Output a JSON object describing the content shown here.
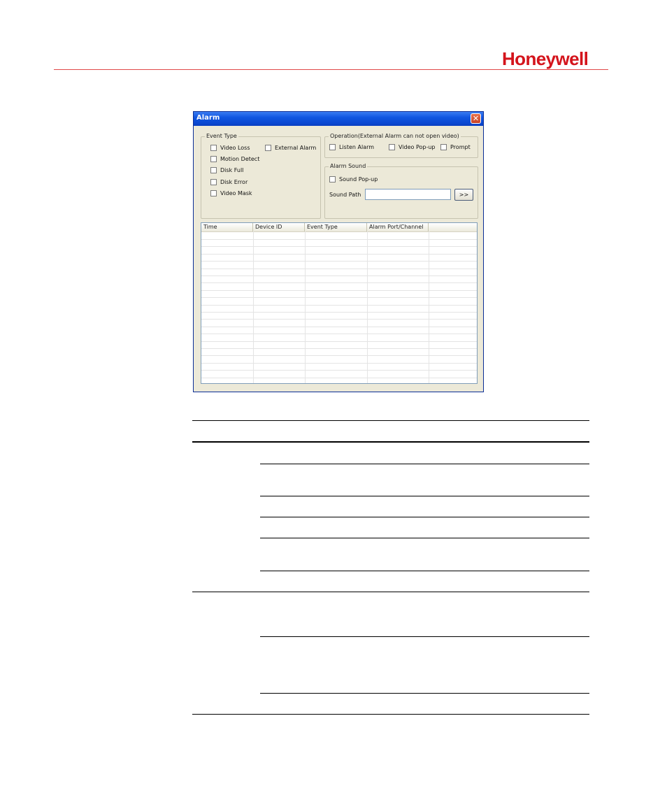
{
  "brand": {
    "logo": "Honeywell",
    "color": "#d4141c"
  },
  "dialog": {
    "title": "Alarm",
    "close_icon": "close-icon",
    "event_type": {
      "legend": "Event Type",
      "options": [
        "Video Loss",
        "External Alarm",
        "Motion Detect",
        "Disk Full",
        "Disk Error",
        "Video Mask"
      ]
    },
    "operation": {
      "legend": "Operation(External Alarm can not open video)",
      "options": [
        "Listen Alarm",
        "Video Pop-up",
        "Prompt"
      ]
    },
    "alarm_sound": {
      "legend": "Alarm Sound",
      "sound_popup": "Sound Pop-up",
      "sound_path_label": "Sound Path",
      "sound_path_value": "",
      "browse_label": ">>"
    },
    "list": {
      "columns": [
        "Time",
        "Device ID",
        "Event Type",
        "Alarm Port/Channel",
        ""
      ],
      "rows": []
    }
  }
}
